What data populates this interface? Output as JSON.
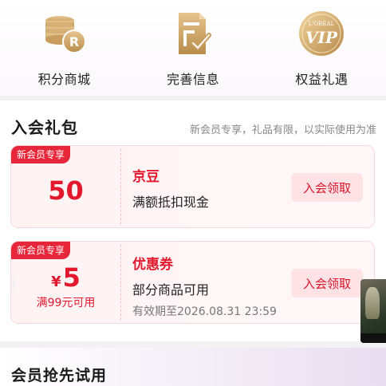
{
  "menu": {
    "items": [
      {
        "label": "积分商城",
        "icon": "coins-icon"
      },
      {
        "label": "完善信息",
        "icon": "document-check-icon"
      },
      {
        "label": "权益礼遇",
        "icon": "vip-badge-icon",
        "badge_brand": "L'ORÉAL",
        "badge_text": "VIP"
      }
    ]
  },
  "gift": {
    "title": "入会礼包",
    "note": "新会员专享，礼品有限，以实际使用为准",
    "coupons": [
      {
        "tag": "新会员专享",
        "amount": "50",
        "name": "京豆",
        "desc": "满额抵扣现金",
        "button": "入会领取"
      },
      {
        "tag": "新会员专享",
        "currency": "¥",
        "amount": "5",
        "condition": "满99元可用",
        "name": "优惠券",
        "desc": "部分商品可用",
        "expiry": "有效期至2026.08.31 23:59",
        "button": "入会领取"
      }
    ]
  },
  "trial": {
    "title": "会员抢先试用"
  },
  "colors": {
    "accent_red": "#e2192d",
    "tag_red": "#e8263a",
    "gold": "#c9a063",
    "button_bg": "#fde2e6"
  }
}
